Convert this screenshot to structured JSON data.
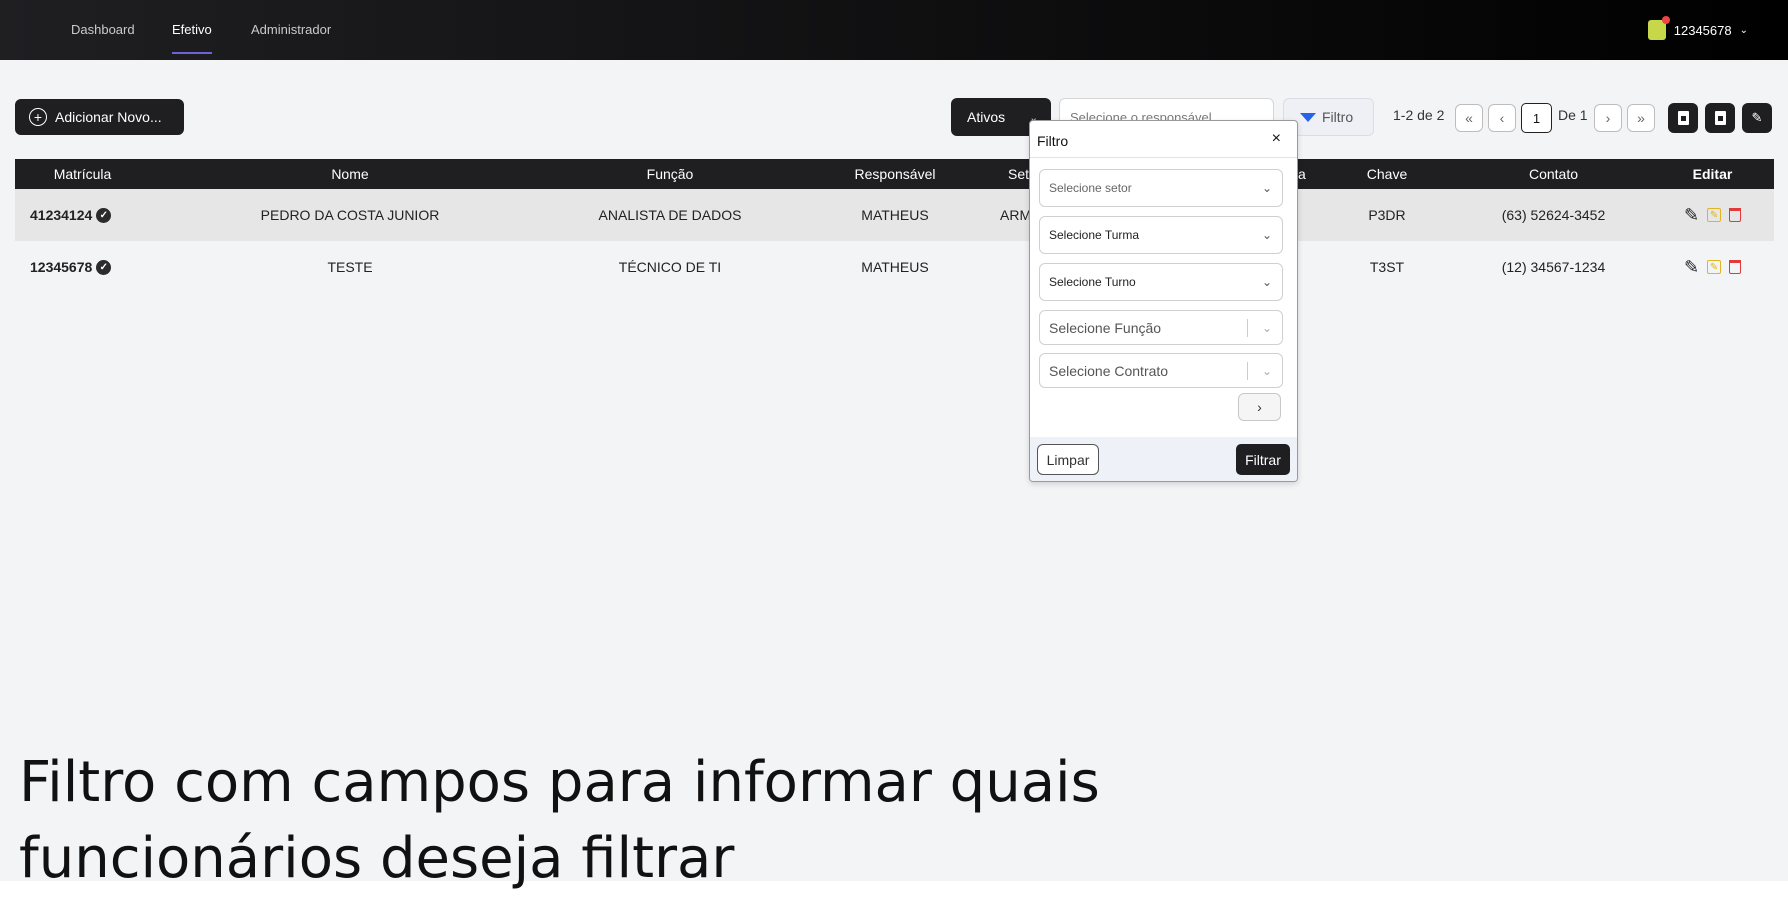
{
  "nav": {
    "tabs": [
      {
        "label": "Dashboard"
      },
      {
        "label": "Efetivo",
        "active": true
      },
      {
        "label": "Administrador"
      }
    ],
    "user": "12345678"
  },
  "toolbar": {
    "add_label": "Adicionar Novo...",
    "status_label": "Ativos",
    "responsavel_placeholder": "Selecione o responsável",
    "filter_label": "Filtro",
    "pagination_range": "1-2 de 2",
    "current_page": "1",
    "page_total": "De 1"
  },
  "table": {
    "headers": [
      "Matrícula",
      "Nome",
      "Função",
      "Responsável",
      "Set",
      "a",
      "Chave",
      "Contato",
      "Editar"
    ],
    "rows": [
      {
        "matricula": "41234124",
        "nome": "PEDRO DA COSTA JUNIOR",
        "funcao": "ANALISTA DE DADOS",
        "responsavel": "MATHEUS",
        "setor": "ARMA",
        "chave": "P3DR",
        "contato": "(63) 52624-3452"
      },
      {
        "matricula": "12345678",
        "nome": "TESTE",
        "funcao": "TÉCNICO DE TI",
        "responsavel": "MATHEUS",
        "setor": "",
        "chave": "T3ST",
        "contato": "(12) 34567-1234"
      }
    ]
  },
  "filter_popover": {
    "title": "Filtro",
    "close": "×",
    "fields": [
      {
        "placeholder": "Selecione setor"
      },
      {
        "placeholder": "Selecione Turma"
      },
      {
        "placeholder": "Selecione Turno"
      },
      {
        "placeholder": "Selecione Função"
      },
      {
        "placeholder": "Selecione Contrato"
      }
    ],
    "clear_label": "Limpar",
    "apply_label": "Filtrar"
  },
  "caption": "Filtro com campos para informar quais funcionários deseja filtrar",
  "colors": {
    "nav_bg": "#0d0d0e",
    "accent": "#6c63d9",
    "dark_button": "#1f1f22",
    "edit_icon": "#e0b520",
    "delete_icon": "#e03a3a"
  }
}
